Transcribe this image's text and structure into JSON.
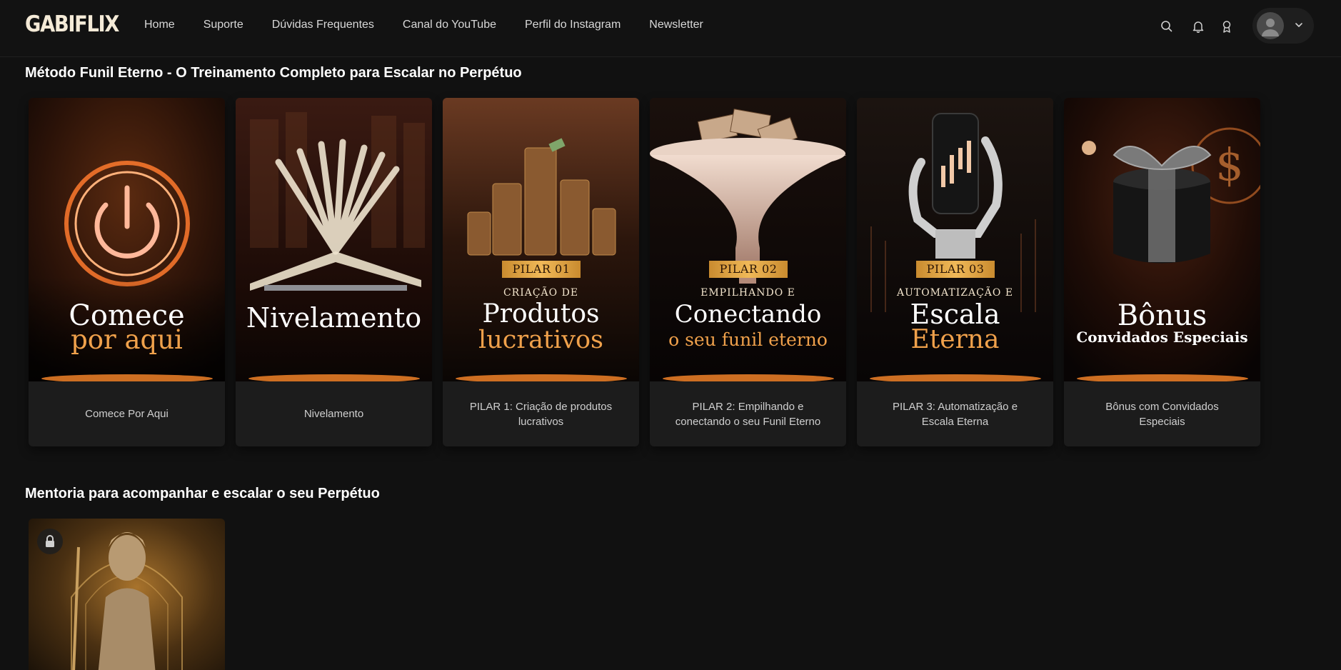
{
  "app": {
    "logo": "GABIFLIX"
  },
  "nav": {
    "items": [
      {
        "label": "Home"
      },
      {
        "label": "Suporte"
      },
      {
        "label": "Dúvidas Frequentes"
      },
      {
        "label": "Canal do YouTube"
      },
      {
        "label": "Perfil do Instagram"
      },
      {
        "label": "Newsletter"
      }
    ]
  },
  "header_icons": [
    "search-icon",
    "bell-icon",
    "award-icon",
    "user-avatar",
    "chevron-down-icon"
  ],
  "sections": [
    {
      "title": "Método Funil Eterno - O Treinamento Completo para Escalar no Perpétuo",
      "cards": [
        {
          "caption": "Comece Por Aqui",
          "art": {
            "line1": "Comece",
            "line2": "por aqui"
          }
        },
        {
          "caption": "Nivelamento",
          "art": {
            "line1": "Nivelamento"
          }
        },
        {
          "caption": "PILAR 1: Criação de produtos lucrativos",
          "art": {
            "badge": "PILAR 01",
            "small": "CRIAÇÃO DE",
            "line1": "Produtos",
            "line2": "lucrativos"
          }
        },
        {
          "caption": "PILAR 2: Empilhando e conectando o seu Funil Eterno",
          "art": {
            "badge": "PILAR 02",
            "small": "EMPILHANDO E",
            "line1": "Conectando",
            "line2": "o seu funil eterno"
          }
        },
        {
          "caption": "PILAR 3: Automatização e Escala Eterna",
          "art": {
            "badge": "PILAR 03",
            "small": "AUTOMATIZAÇÃO E",
            "line1": "Escala",
            "line2": "Eterna"
          }
        },
        {
          "caption": "Bônus com Convidados Especiais",
          "art": {
            "line1": "Bônus",
            "line2": "Convidados Especiais"
          }
        }
      ]
    },
    {
      "title": "Mentoria para acompanhar e escalar o seu Perpétuo",
      "cards": [
        {
          "locked": true
        }
      ]
    }
  ],
  "colors": {
    "background": "#111111",
    "card": "#1c1c1c",
    "accent_gold": "#f0a14b",
    "badge_gold": "#f0b958"
  }
}
